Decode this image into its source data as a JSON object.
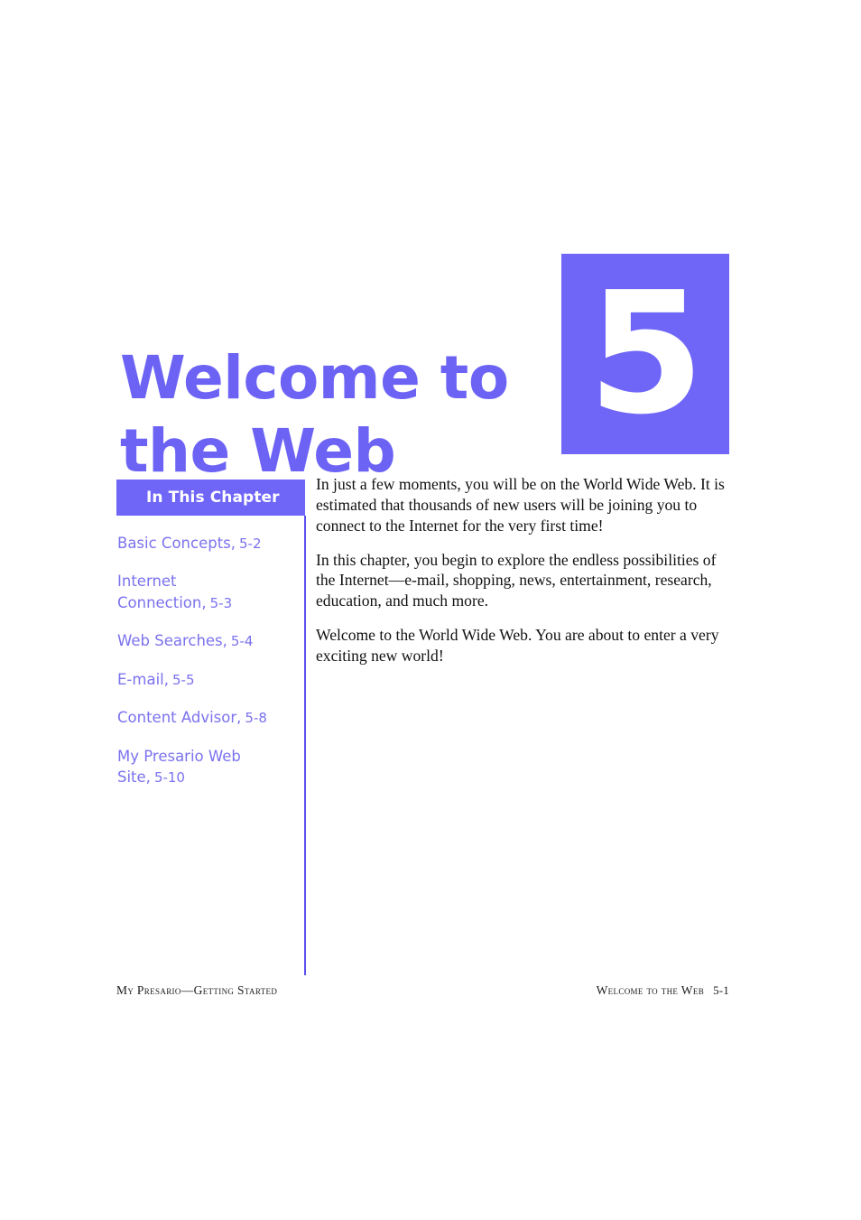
{
  "chapter": {
    "number": "5",
    "title_lines": [
      "Welcome to",
      "the Web"
    ],
    "accent_color": "#6F66F8",
    "title_color": "#6C63F5"
  },
  "sidebar": {
    "header_label": "In This Chapter",
    "items": [
      {
        "label": "Basic Concepts,",
        "page": "5-2"
      },
      {
        "label": "Internet Connection,",
        "page": "5-3"
      },
      {
        "label": "Web Searches,",
        "page": "5-4"
      },
      {
        "label": "E-mail,",
        "page": "5-5"
      },
      {
        "label": "Content Advisor,",
        "page": "5-8"
      },
      {
        "label": "My Presario Web Site,",
        "page": "5-10"
      }
    ]
  },
  "body": {
    "paragraphs": [
      "In just a few moments, you will be on the World Wide Web. It is estimated that thousands of new users will be joining you to connect to the Internet for the very first time!",
      "In this chapter, you begin to explore the endless possibilities of the Internet—e-mail, shopping, news, entertainment, research, education, and much more.",
      "Welcome to the World Wide Web. You are about to enter a very exciting new world!"
    ]
  },
  "footer": {
    "left": "My Presario—Getting Started",
    "right_title": "Welcome to the Web",
    "right_page": "5-1"
  }
}
